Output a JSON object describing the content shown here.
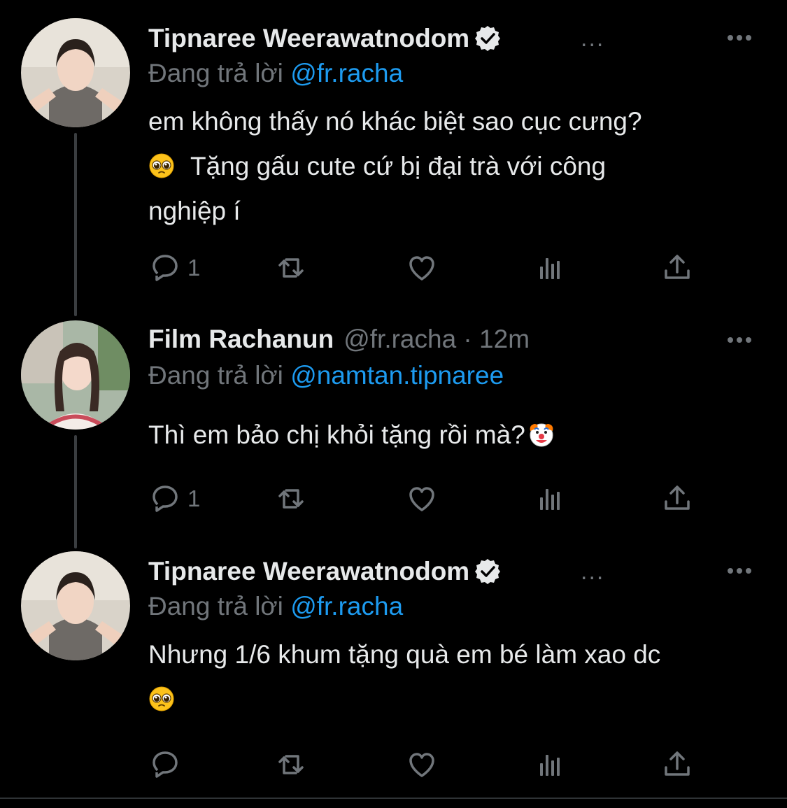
{
  "tweets": [
    {
      "name": "Tipnaree Weerawatnodom",
      "handle": "",
      "time": "",
      "verified": true,
      "ellipsis": "...",
      "reply_prefix": "Đang trả lời",
      "reply_to": "@fr.racha",
      "text_lines": [
        "em không thấy nó khác biệt sao cục cưng?",
        "Tặng gấu cute cứ bị đại trà với công",
        "nghiệp í"
      ],
      "reply_count": "1",
      "emoji": "pleading-face"
    },
    {
      "name": "Film Rachanun",
      "handle": "@fr.racha · 12m",
      "verified": false,
      "reply_prefix": "Đang trả lời",
      "reply_to": "@namtan.tipnaree",
      "text": "Thì em bảo chị khỏi tặng rồi mà?",
      "reply_count": "1",
      "emoji": "clown-face"
    },
    {
      "name": "Tipnaree Weerawatnodom",
      "verified": true,
      "ellipsis": "...",
      "reply_prefix": "Đang trả lời",
      "reply_to": "@fr.racha",
      "text": "Nhưng 1/6 khum tặng quà em bé làm xao dc",
      "reply_count": "",
      "emoji": "pleading-face"
    }
  ],
  "colors": {
    "background": "#000000",
    "text": "#e7e9ea",
    "muted": "#71767b",
    "link": "#1d9bf0",
    "thread_line": "#3a3d40"
  },
  "icons": [
    "reply-icon",
    "retweet-icon",
    "like-icon",
    "views-icon",
    "share-icon",
    "verified-badge-icon",
    "more-options-icon"
  ]
}
